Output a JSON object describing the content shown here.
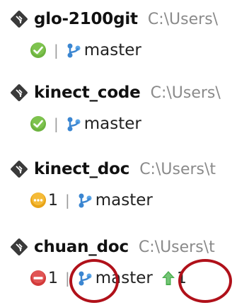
{
  "repositories": [
    {
      "name": "glo-2100git",
      "path": "C:\\Users\\",
      "status": "clean",
      "status_icon": "check-circle-icon",
      "branch": "master"
    },
    {
      "name": "kinect_code",
      "path": "C:\\Users\\",
      "status": "clean",
      "status_icon": "check-circle-icon",
      "branch": "master"
    },
    {
      "name": "kinect_doc",
      "path": "C:\\Users\\t",
      "status": "modified",
      "status_icon": "modified-circle-icon",
      "status_count": "1",
      "branch": "master"
    },
    {
      "name": "chuan_doc",
      "path": "C:\\Users\\t",
      "status": "error",
      "status_icon": "minus-circle-icon",
      "status_count": "1",
      "branch": "master",
      "ahead_icon": "up-arrow-icon",
      "ahead_count": "1"
    }
  ],
  "separator": "|",
  "colors": {
    "clean": "#6db33f",
    "modified": "#e8a317",
    "error": "#d23a3a",
    "branch_icon": "#3b86d1",
    "ahead_arrow": "#4caf50",
    "highlight": "#b0111a",
    "repo_name": "#111111",
    "repo_path": "#8a8a8a"
  }
}
